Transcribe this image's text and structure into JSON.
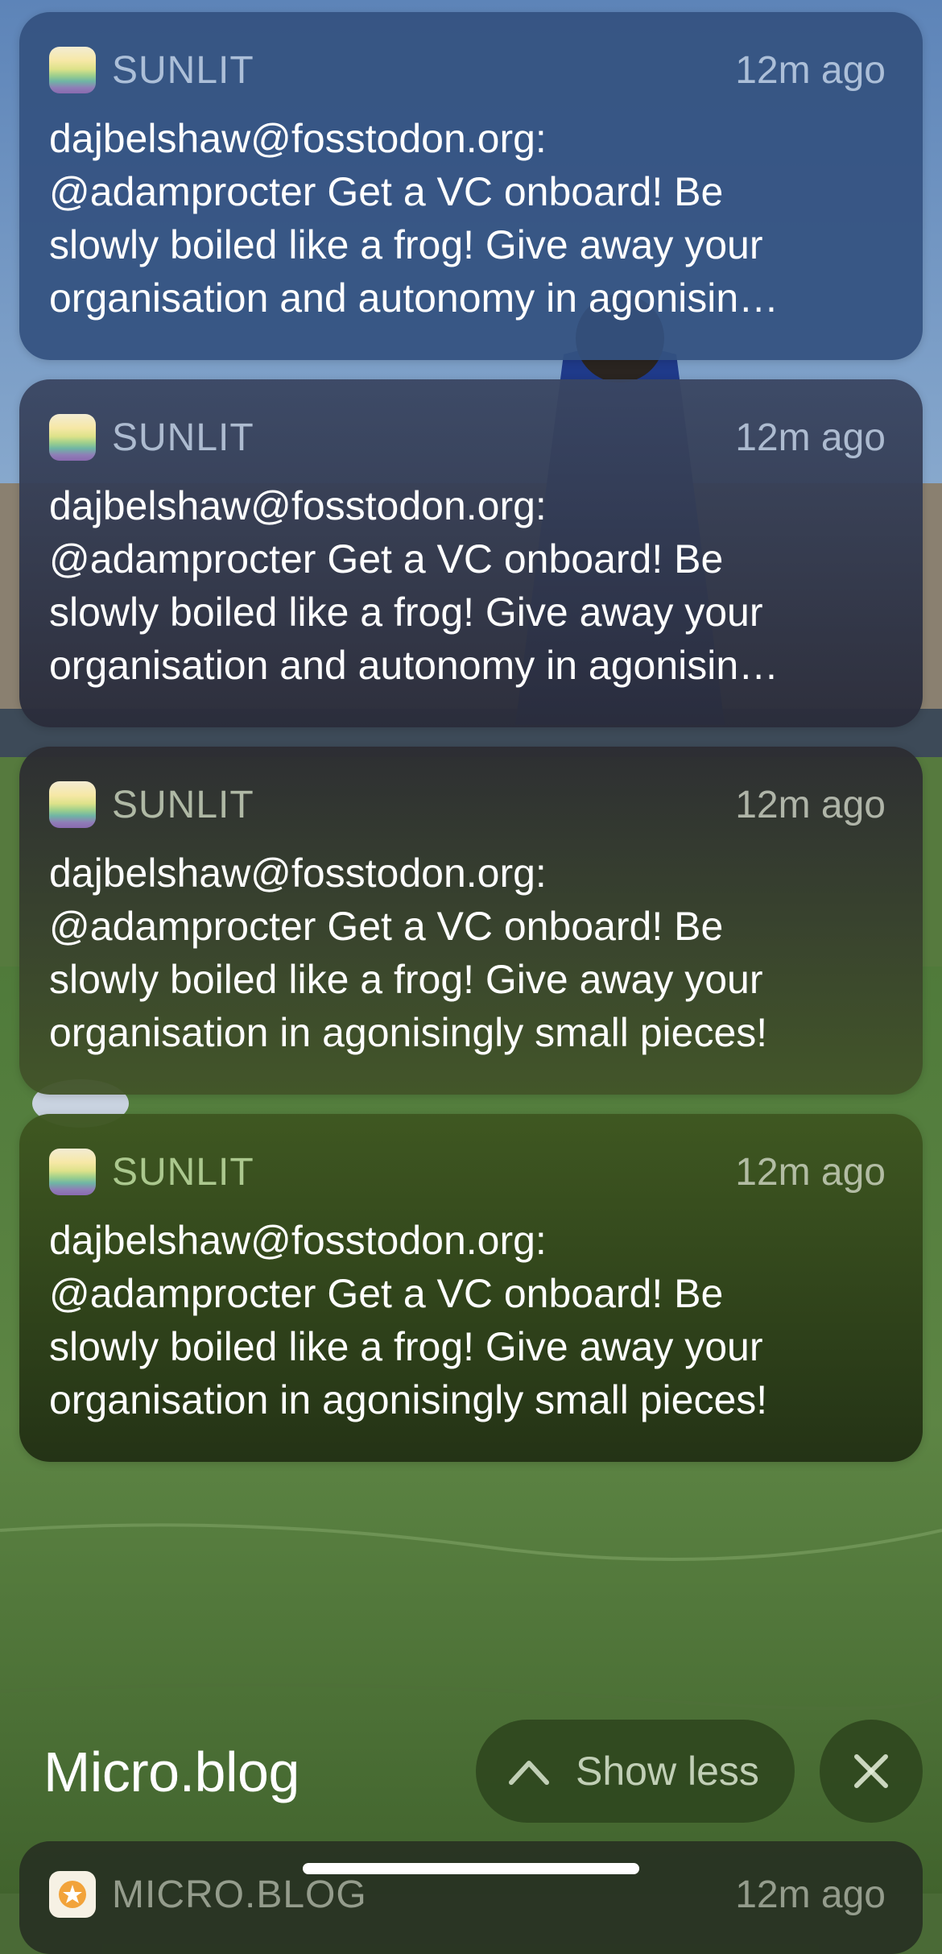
{
  "notifications": [
    {
      "app": "SUNLIT",
      "time": "12m ago",
      "lines": [
        "dajbelshaw@fosstodon.org:",
        "@adamprocter Get a VC onboard! Be",
        "slowly boiled like a frog! Give away your",
        "organisation and autonomy in agonisin…"
      ]
    },
    {
      "app": "SUNLIT",
      "time": "12m ago",
      "lines": [
        "dajbelshaw@fosstodon.org:",
        "@adamprocter Get a VC onboard! Be",
        "slowly boiled like a frog! Give away your",
        "organisation and autonomy in agonisin…"
      ]
    },
    {
      "app": "SUNLIT",
      "time": "12m ago",
      "lines": [
        "dajbelshaw@fosstodon.org:",
        "@adamprocter Get a VC onboard! Be",
        "slowly boiled like a frog! Give away your",
        "organisation in agonisingly small pieces!"
      ]
    },
    {
      "app": "SUNLIT",
      "time": "12m ago",
      "lines": [
        "dajbelshaw@fosstodon.org:",
        "@adamprocter Get a VC onboard! Be",
        "slowly boiled like a frog! Give away your",
        "organisation in agonisingly small pieces!"
      ]
    }
  ],
  "group": {
    "title": "Micro.blog",
    "show_less_label": "Show less"
  },
  "next_group": {
    "app": "MICRO.BLOG",
    "time": "12m ago"
  }
}
